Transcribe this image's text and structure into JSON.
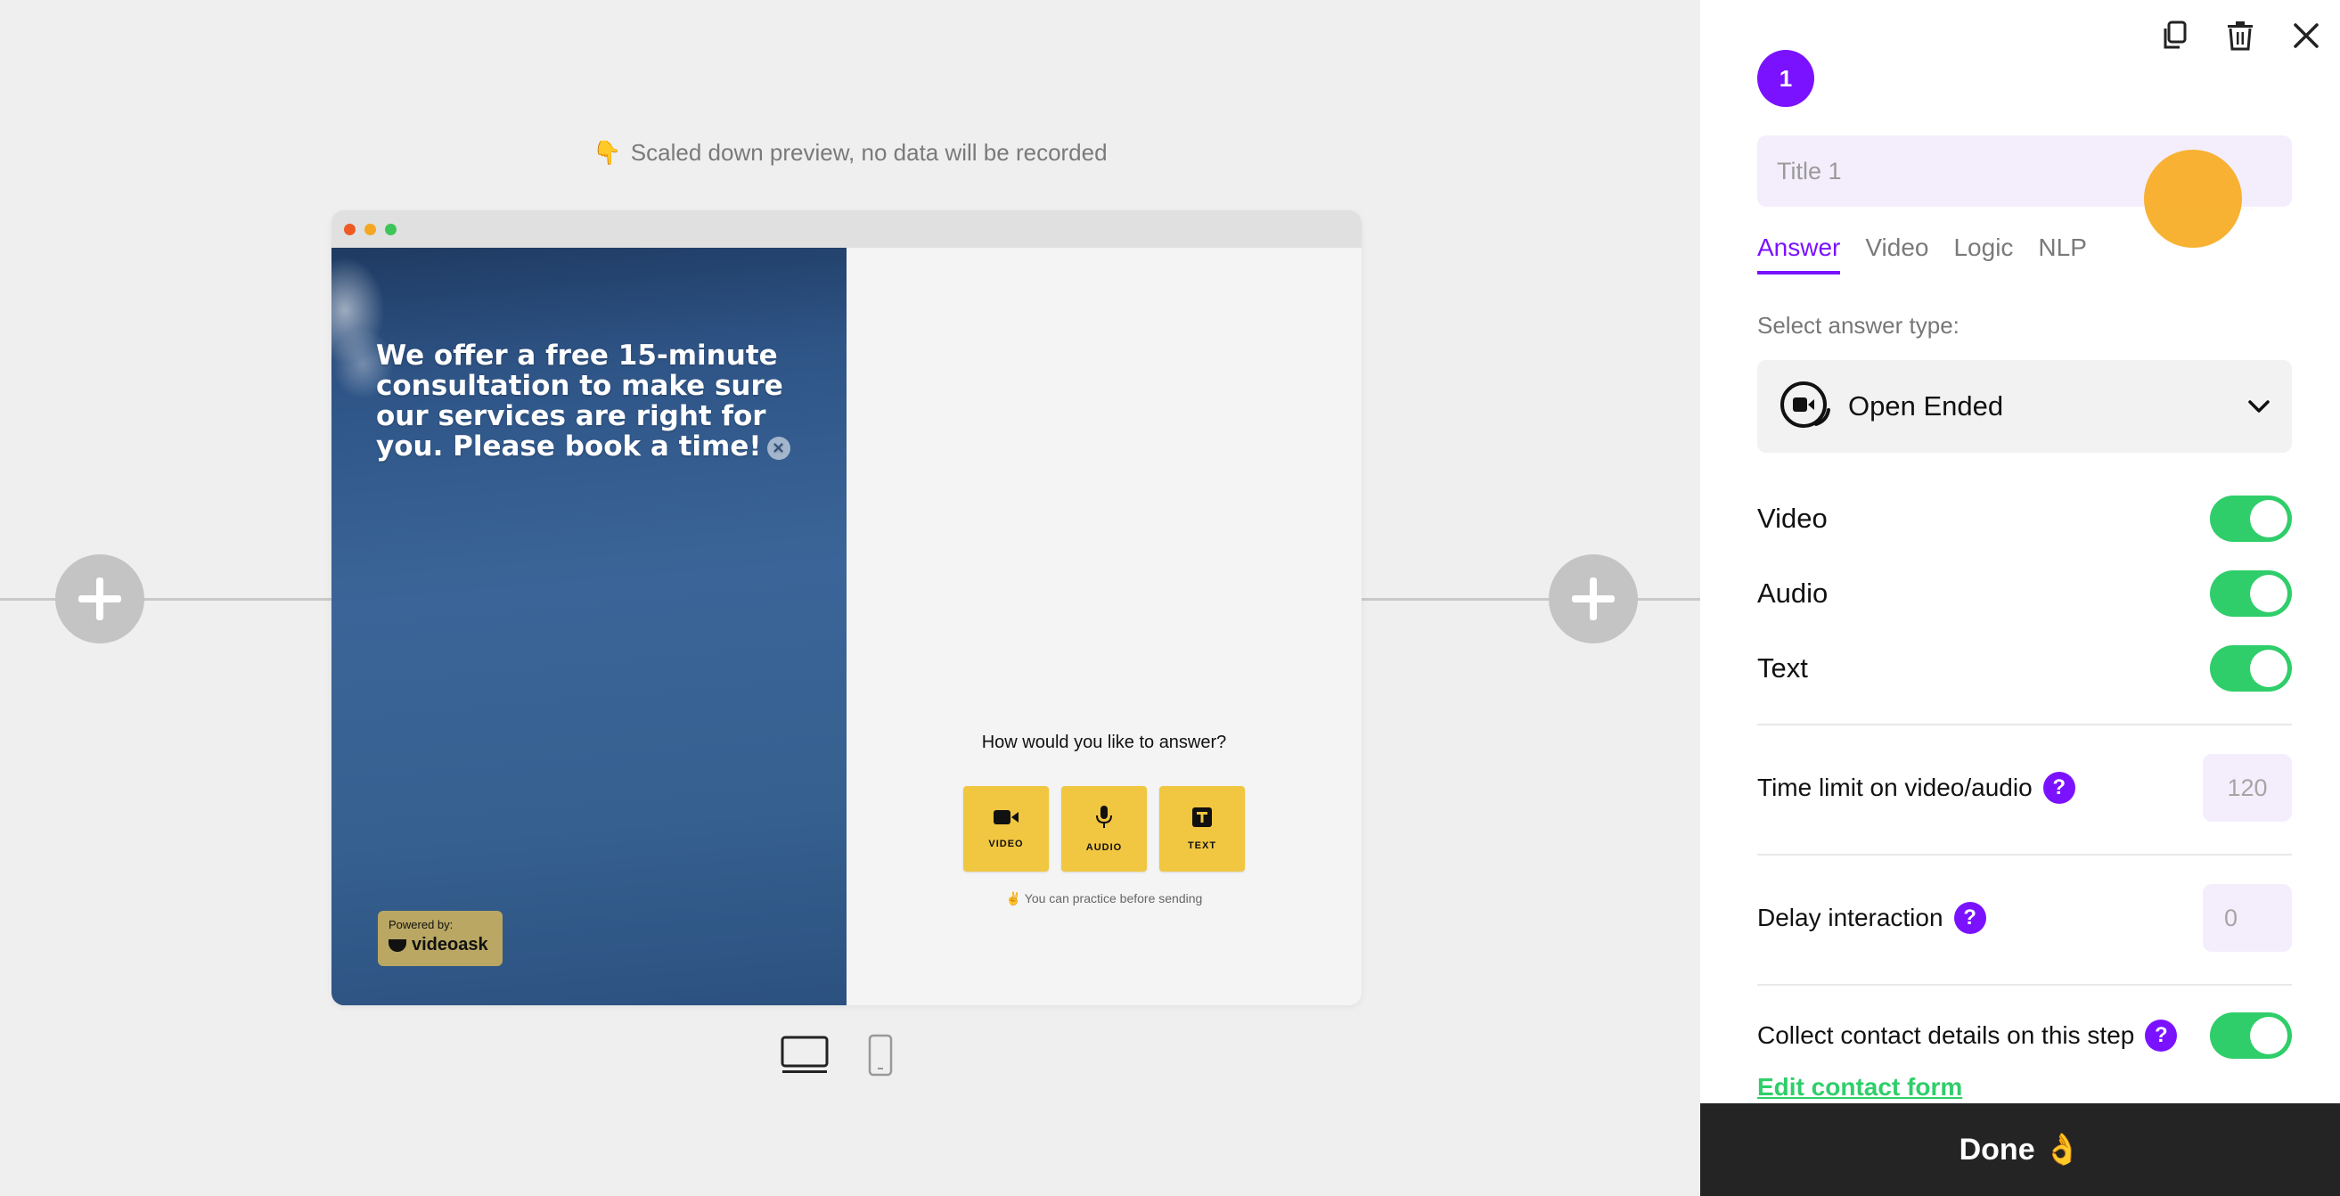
{
  "preview": {
    "note": "Scaled down preview, no data will be recorded",
    "note_icon": "👇"
  },
  "video": {
    "message": "We offer a free 15-minute consultation to make sure our services are right for you. Please book a time!",
    "close_glyph": "×",
    "powered_label": "Powered by:",
    "brand": "videoask"
  },
  "answer": {
    "question": "How would you like to answer?",
    "options": [
      {
        "label": "VIDEO",
        "icon": "video-camera-icon"
      },
      {
        "label": "AUDIO",
        "icon": "microphone-icon"
      },
      {
        "label": "TEXT",
        "icon": "text-icon"
      }
    ],
    "practice_note": "✌️ You can practice before sending"
  },
  "devices": {
    "desktop": "desktop-icon",
    "mobile": "mobile-icon",
    "selected": "desktop"
  },
  "panel": {
    "step_number": "1",
    "title_placeholder": "Title 1",
    "tabs": [
      {
        "label": "Answer",
        "active": true
      },
      {
        "label": "Video",
        "active": false
      },
      {
        "label": "Logic",
        "active": false
      },
      {
        "label": "NLP",
        "active": false
      }
    ],
    "select_label": "Select answer type:",
    "answer_type": "Open Ended",
    "toggles": {
      "video": {
        "label": "Video",
        "on": true
      },
      "audio": {
        "label": "Audio",
        "on": true
      },
      "text": {
        "label": "Text",
        "on": true
      }
    },
    "time_limit": {
      "label": "Time limit on video/audio",
      "placeholder": "120"
    },
    "delay": {
      "label": "Delay interaction",
      "placeholder": "0"
    },
    "contact": {
      "label": "Collect contact details on this step",
      "on": true
    },
    "help_glyph": "?",
    "edit_contact": "Edit contact form",
    "done": "Done 👌"
  },
  "colors": {
    "accent": "#7a12ff",
    "toggle_on": "#2fce6a",
    "answer_button": "#f1c641",
    "done_bar": "#242424"
  }
}
